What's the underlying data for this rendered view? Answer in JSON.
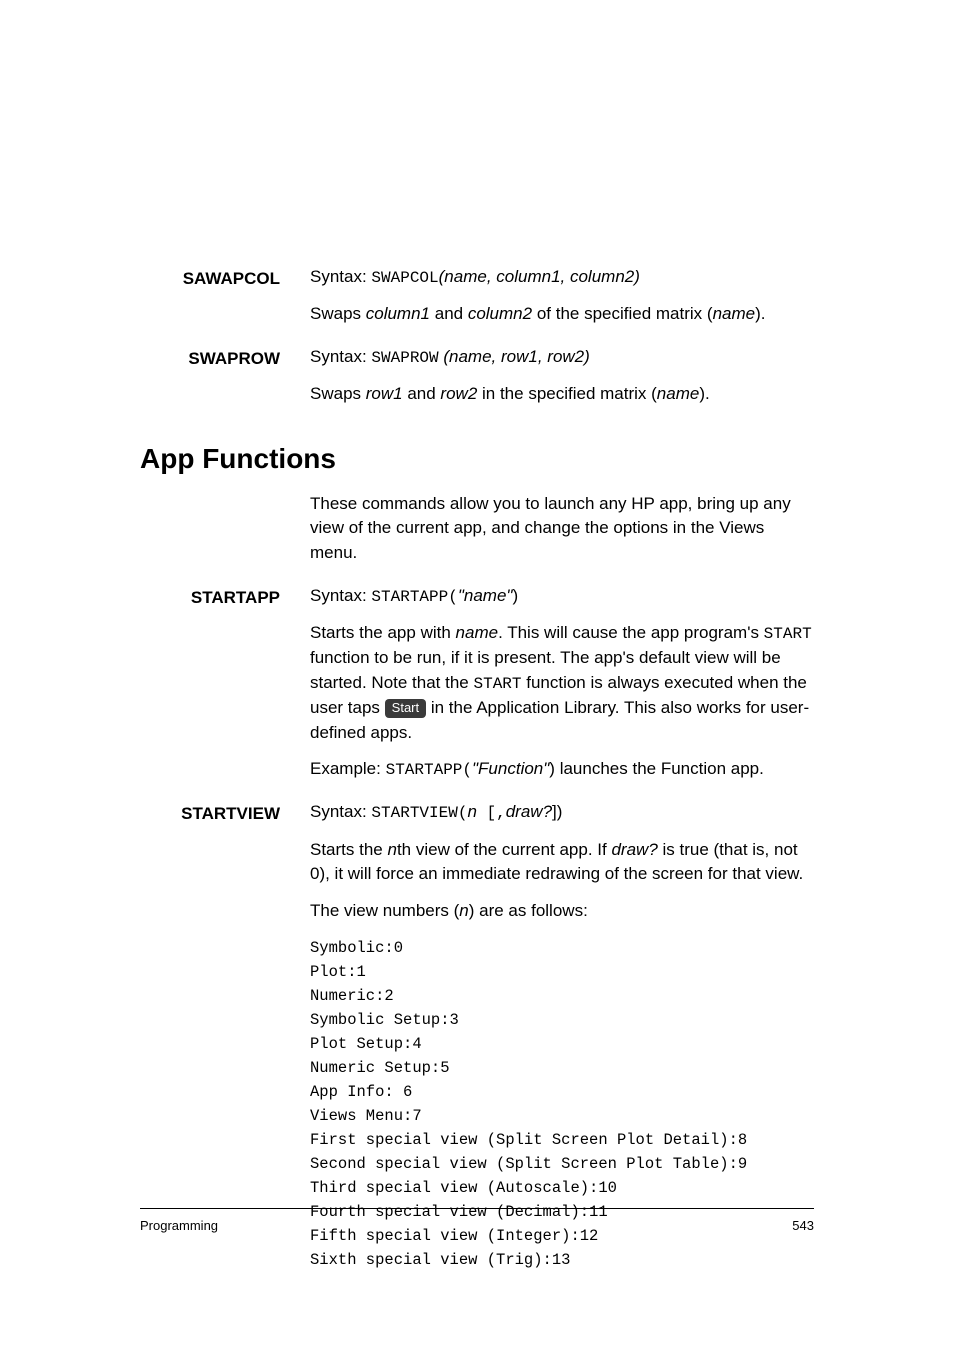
{
  "sawapcol": {
    "label": "SAWAPCOL",
    "syntax_prefix": "Syntax: ",
    "syntax_cmd": "SWAPCOL",
    "syntax_args": "(name, column1, column2)",
    "desc1_a": "Swaps ",
    "desc1_b": "column1",
    "desc1_c": " and ",
    "desc1_d": "column2",
    "desc1_e": " of the specified matrix (",
    "desc1_f": "name",
    "desc1_g": ")."
  },
  "swaprow": {
    "label": "SWAPROW",
    "syntax_prefix": "Syntax: ",
    "syntax_cmd": "SWAPROW",
    "syntax_args": " (name, row1, row2)",
    "desc_a": "Swaps ",
    "desc_b": "row1",
    "desc_c": " and ",
    "desc_d": "row2",
    "desc_e": " in the specified matrix (",
    "desc_f": "name",
    "desc_g": ")."
  },
  "section": "App Functions",
  "intro": "These commands allow you to launch any HP app, bring up any view of the current app, and change the options in the Views menu.",
  "startapp": {
    "label": "STARTAPP",
    "syntax_prefix": "Syntax: ",
    "syntax_cmd": "STARTAPP(",
    "syntax_arg": "\"name\"",
    "syntax_close": ")",
    "p1_a": "Starts the app with ",
    "p1_b": "name",
    "p1_c": ". This will cause the app program's ",
    "p1_d": "START",
    "p1_e": " function to be run, if it is present. The app's default view will be started. Note that the ",
    "p1_f": "START",
    "p1_g": " function is always executed when the user taps ",
    "p1_btn": "Start",
    "p1_h": " in the Application Library. This also works for user-defined apps.",
    "ex_prefix": "Example: ",
    "ex_cmd": "STARTAPP(",
    "ex_arg": "\"Function\"",
    "ex_close": ")",
    "ex_tail": " launches the Function app."
  },
  "startview": {
    "label": "STARTVIEW",
    "syntax_prefix": "Syntax: ",
    "syntax_cmd": "STARTVIEW(",
    "syntax_n": "n",
    "syntax_mid": " [,",
    "syntax_draw": "draw?",
    "syntax_close": "])",
    "p1_a": "Starts the ",
    "p1_b": "n",
    "p1_c": "th view of the current app. If ",
    "p1_d": "draw?",
    "p1_e": " is true (that is, not 0), it will force an immediate redrawing of the screen for that view.",
    "p2_a": "The view numbers (",
    "p2_b": "n",
    "p2_c": ") are as follows:",
    "views": "Symbolic:0\nPlot:1\nNumeric:2\nSymbolic Setup:3\nPlot Setup:4\nNumeric Setup:5\nApp Info: 6\nViews Menu:7\nFirst special view (Split Screen Plot Detail):8\nSecond special view (Split Screen Plot Table):9\nThird special view (Autoscale):10\nFourth special view (Decimal):11\nFifth special view (Integer):12\nSixth special view (Trig):13"
  },
  "footer": {
    "left": "Programming",
    "right": "543"
  }
}
